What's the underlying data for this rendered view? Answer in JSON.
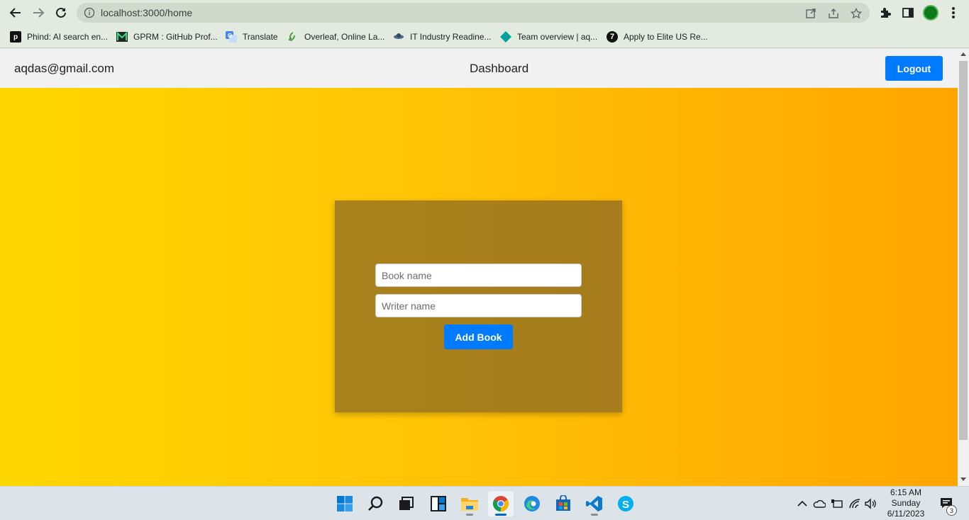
{
  "browser": {
    "url": "localhost:3000/home",
    "bookmarks": [
      {
        "label": "Phind: AI search en...",
        "icon": "phind-icon"
      },
      {
        "label": "GPRM : GitHub Prof...",
        "icon": "gprm-icon"
      },
      {
        "label": "Translate",
        "icon": "translate-icon"
      },
      {
        "label": "Overleaf, Online La...",
        "icon": "overleaf-icon"
      },
      {
        "label": "IT Industry Readine...",
        "icon": "it-industry-icon"
      },
      {
        "label": "Team overview | aq...",
        "icon": "team-icon"
      },
      {
        "label": "Apply to Elite US Re...",
        "icon": "apply-icon"
      }
    ]
  },
  "app": {
    "user_email": "aqdas@gmail.com",
    "title": "Dashboard",
    "logout_label": "Logout",
    "form": {
      "book_placeholder": "Book name",
      "writer_placeholder": "Writer name",
      "submit_label": "Add Book"
    },
    "colors": {
      "primary": "#007bff",
      "card": "#a8821c",
      "gradient_start": "#ffd700",
      "gradient_end": "#ffa500"
    }
  },
  "taskbar": {
    "apps": [
      "start-icon",
      "search-icon",
      "task-view-icon",
      "widgets-icon",
      "file-explorer-icon",
      "chrome-icon",
      "edge-icon",
      "store-icon",
      "vscode-icon",
      "skype-icon"
    ],
    "clock": {
      "time": "6:15 AM",
      "day": "Sunday",
      "date": "6/11/2023"
    },
    "notification_count": "3"
  }
}
